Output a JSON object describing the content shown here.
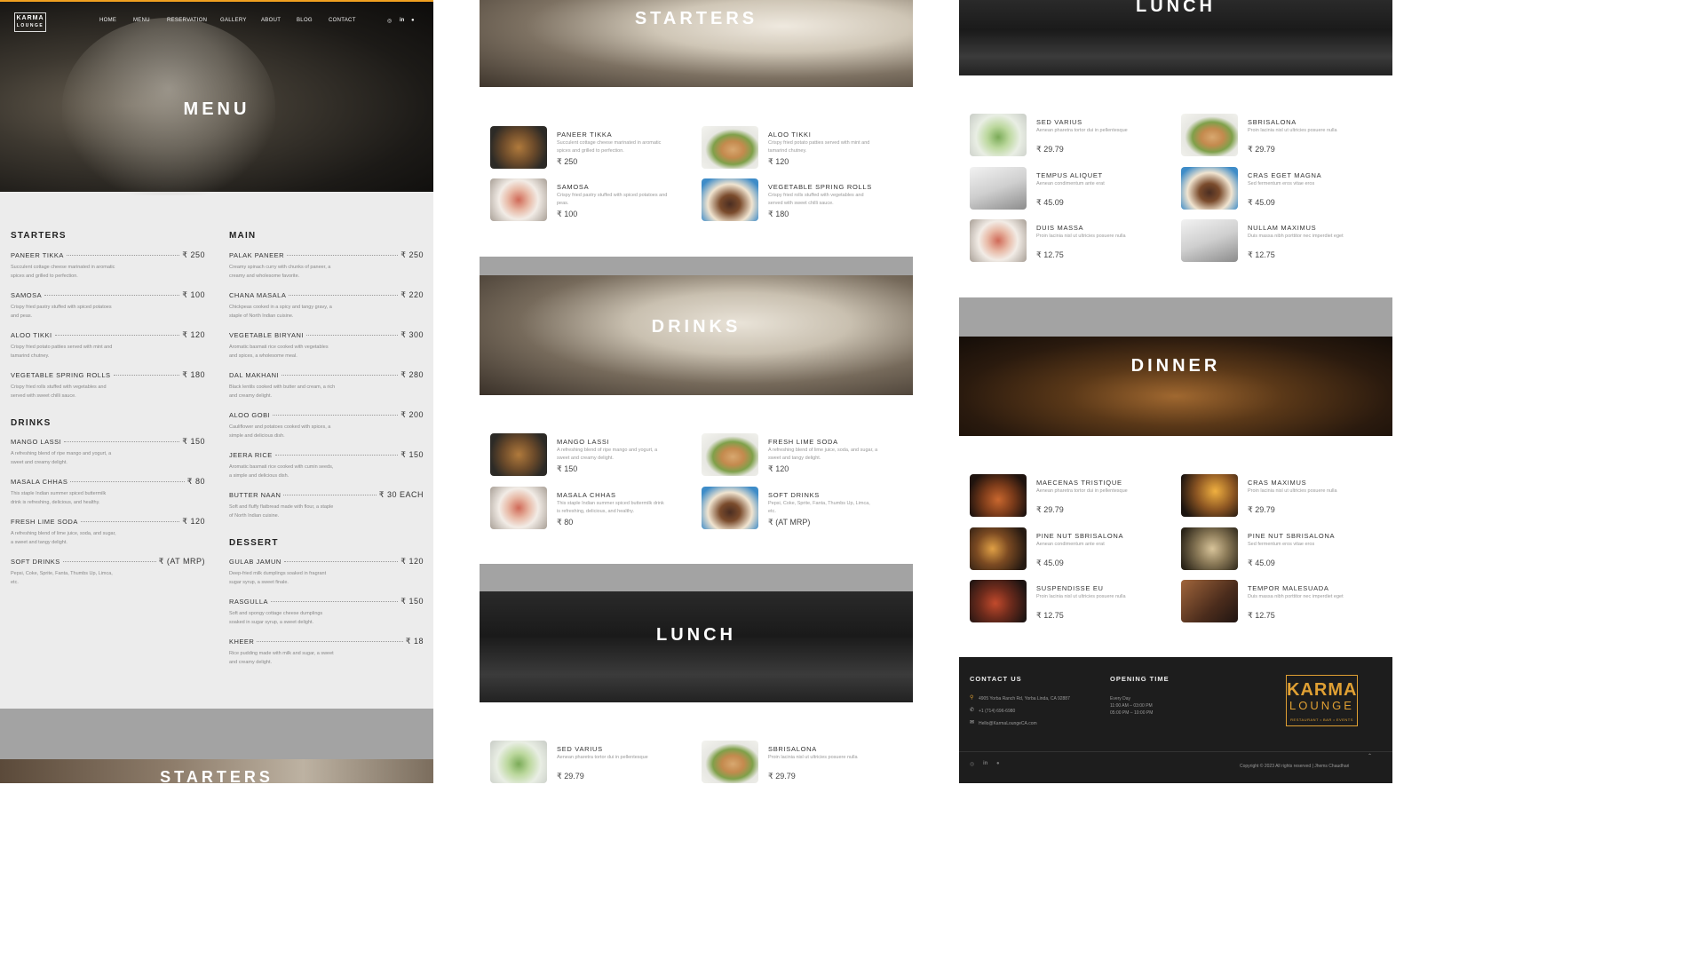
{
  "nav": {
    "logo_line1": "KARMA",
    "logo_line2": "LOUNGE",
    "items": [
      "HOME",
      "MENU",
      "RESERVATION",
      "GALLERY",
      "ABOUT",
      "BLOG",
      "CONTACT"
    ],
    "social_icons": [
      "instagram-icon",
      "linkedin-icon",
      "github-icon"
    ]
  },
  "hero": {
    "title": "MENU",
    "accent_color": "#f0a020"
  },
  "price_list": {
    "starters": {
      "heading": "STARTERS",
      "items": [
        {
          "name": "PANEER TIKKA",
          "price": "₹ 250",
          "desc": "Succulent cottage cheese marinated in aromatic spices and grilled to perfection."
        },
        {
          "name": "SAMOSA",
          "price": "₹ 100",
          "desc": "Crispy fried pastry stuffed with spiced potatoes and peas."
        },
        {
          "name": "ALOO TIKKI",
          "price": "₹ 120",
          "desc": "Crispy fried potato patties served with mint and tamarind chutney."
        },
        {
          "name": "VEGETABLE SPRING ROLLS",
          "price": "₹ 180",
          "desc": "Crispy fried rolls stuffed with vegetables and served with sweet chilli sauce."
        }
      ]
    },
    "drinks": {
      "heading": "DRINKS",
      "items": [
        {
          "name": "MANGO LASSI",
          "price": "₹ 150",
          "desc": "A refreshing blend of ripe mango and yogurt, a sweet and creamy delight."
        },
        {
          "name": "MASALA CHHAS",
          "price": "₹ 80",
          "desc": "This staple Indian summer spiced buttermilk drink is refreshing, delicious, and healthy."
        },
        {
          "name": "FRESH LIME SODA",
          "price": "₹ 120",
          "desc": "A refreshing blend of lime juice, soda, and sugar, a sweet and tangy delight."
        },
        {
          "name": "SOFT DRINKS",
          "price": "₹ (AT MRP)",
          "desc": "Pepsi, Coke, Sprite, Fanta, Thumbs Up, Limca, etc."
        }
      ]
    },
    "main": {
      "heading": "MAIN",
      "items": [
        {
          "name": "PALAK PANEER",
          "price": "₹ 250",
          "desc": "Creamy spinach curry with chunks of paneer, a creamy and wholesome favorite."
        },
        {
          "name": "CHANA MASALA",
          "price": "₹ 220",
          "desc": "Chickpeas cooked in a spicy and tangy gravy, a staple of North Indian cuisine."
        },
        {
          "name": "VEGETABLE BIRYANI",
          "price": "₹ 300",
          "desc": "Aromatic basmati rice cooked with vegetables and spices, a wholesome meal."
        },
        {
          "name": "DAL MAKHANI",
          "price": "₹ 280",
          "desc": "Black lentils cooked with butter and cream, a rich and creamy delight."
        },
        {
          "name": "ALOO GOBI",
          "price": "₹ 200",
          "desc": "Cauliflower and potatoes cooked with spices, a simple and delicious dish."
        },
        {
          "name": "JEERA RICE",
          "price": "₹ 150",
          "desc": "Aromatic basmati rice cooked with cumin seeds, a simple and delicious dish."
        },
        {
          "name": "BUTTER NAAN",
          "price": "₹ 30 EACH",
          "desc": "Soft and fluffy flatbread made with flour, a staple of North Indian cuisine."
        }
      ]
    },
    "dessert": {
      "heading": "DESSERT",
      "items": [
        {
          "name": "GULAB JAMUN",
          "price": "₹ 120",
          "desc": "Deep-fried milk dumplings soaked in fragrant sugar syrup, a sweet finale."
        },
        {
          "name": "RASGULLA",
          "price": "₹ 150",
          "desc": "Soft and spongy cottage cheese dumplings soaked in sugar syrup, a sweet delight."
        },
        {
          "name": "KHEER",
          "price": "₹ 18",
          "desc": "Rice pudding made with milk and sugar, a sweet and creamy delight."
        }
      ]
    }
  },
  "banners": {
    "starters": "STARTERS",
    "drinks": "DRINKS",
    "lunch": "LUNCH",
    "dinner": "DINNER"
  },
  "cards": {
    "starters": [
      {
        "name": "PANEER TIKKA",
        "desc": "Succulent cottage cheese marinated in aromatic spices and grilled to perfection.",
        "price": "₹ 250"
      },
      {
        "name": "ALOO TIKKI",
        "desc": "Crispy fried potato patties served with mint and tamarind chutney.",
        "price": "₹ 120"
      },
      {
        "name": "SAMOSA",
        "desc": "Crispy fried pastry stuffed with spiced potatoes and peas.",
        "price": "₹ 100"
      },
      {
        "name": "VEGETABLE SPRING ROLLS",
        "desc": "Crispy fried rolls stuffed with vegetables and served with sweet chilli sauce.",
        "price": "₹ 180"
      }
    ],
    "drinks": [
      {
        "name": "MANGO LASSI",
        "desc": "A refreshing blend of ripe mango and yogurt, a sweet and creamy delight.",
        "price": "₹ 150"
      },
      {
        "name": "FRESH LIME SODA",
        "desc": "A refreshing blend of lime juice, soda, and sugar, a sweet and tangy delight.",
        "price": "₹ 120"
      },
      {
        "name": "MASALA CHHAS",
        "desc": "This staple Indian summer spiced buttermilk drink is refreshing, delicious, and healthy.",
        "price": "₹ 80"
      },
      {
        "name": "SOFT DRINKS",
        "desc": "Pepsi, Coke, Sprite, Fanta, Thumbs Up, Limca, etc.",
        "price": "₹ (AT MRP)"
      }
    ],
    "lunch_preview": [
      {
        "name": "SED VARIUS",
        "desc": "Aenean pharetra tortor dui in pellentesque",
        "price": "₹ 29.79"
      },
      {
        "name": "SBRISALONA",
        "desc": "Proin lacinia nisl ut ultricies posuere nulla",
        "price": "₹ 29.79"
      }
    ],
    "lunch": [
      {
        "name": "SED VARIUS",
        "desc": "Aenean pharetra tortor dui in pellentesque",
        "price": "₹ 29.79"
      },
      {
        "name": "SBRISALONA",
        "desc": "Proin lacinia nisl ut ultricies posuere nulla",
        "price": "₹ 29.79"
      },
      {
        "name": "TEMPUS ALIQUET",
        "desc": "Aenean condimentum ante erat",
        "price": "₹ 45.09"
      },
      {
        "name": "CRAS EGET MAGNA",
        "desc": "Sed fermentum eros vitae eros",
        "price": "₹ 45.09"
      },
      {
        "name": "DUIS MASSA",
        "desc": "Proin lacinia nisl ut ultricies posuere nulla",
        "price": "₹ 12.75"
      },
      {
        "name": "NULLAM MAXIMUS",
        "desc": "Duis massa nibh porttitor nec imperdiet eget",
        "price": "₹ 12.75"
      }
    ],
    "dinner": [
      {
        "name": "MAECENAS TRISTIQUE",
        "desc": "Aenean pharetra tortor dui in pellentesque",
        "price": "₹ 29.79"
      },
      {
        "name": "CRAS MAXIMUS",
        "desc": "Proin lacinia nisl ut ultricies posuere nulla",
        "price": "₹ 29.79"
      },
      {
        "name": "PINE NUT SBRISALONA",
        "desc": "Aenean condimentum ante erat",
        "price": "₹ 45.09"
      },
      {
        "name": "PINE NUT SBRISALONA",
        "desc": "Sed fermentum eros vitae eros",
        "price": "₹ 45.09"
      },
      {
        "name": "SUSPENDISSE EU",
        "desc": "Proin lacinia nisl ut ultricies posuere nulla",
        "price": "₹ 12.75"
      },
      {
        "name": "TEMPOR MALESUADA",
        "desc": "Duis massa nibh porttitor nec imperdiet eget",
        "price": "₹ 12.75"
      }
    ]
  },
  "footer": {
    "contact_heading": "CONTACT US",
    "address": "4905 Yorba Ranch Rd, Yorba Linda, CA 92887",
    "phone": "+1 (714) 696-6980",
    "email": "Hello@KarmaLoungeCA.com",
    "hours_heading": "OPENING TIME",
    "hours_line1": "Every Day",
    "hours_line2": "11:00 AM – 03:00 PM",
    "hours_line3": "05:00 PM – 10:00 PM",
    "logo_line1": "KARMA",
    "logo_line2": "LOUNGE",
    "logo_tagline": "RESTAURANT • BAR • EVENTS",
    "logo_color": "#e0a033",
    "copyright": "Copyright © 2023 All rights reserved | Jhems Chaudhari"
  }
}
